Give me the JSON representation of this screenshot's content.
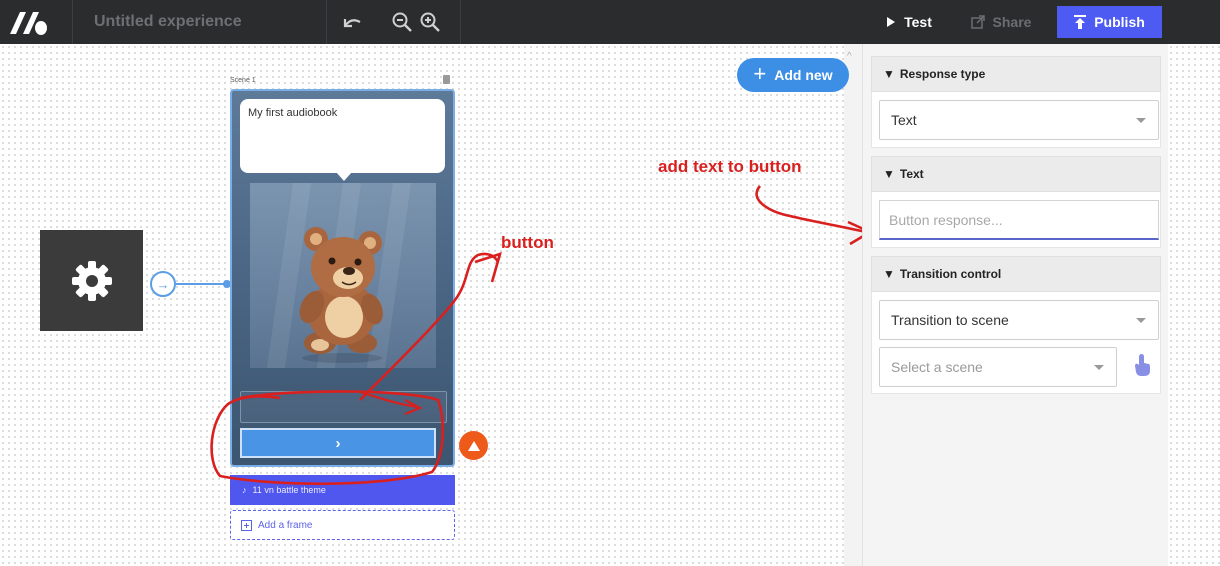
{
  "app": {
    "title": "Untitled experience",
    "buttons": {
      "test": "Test",
      "share": "Share",
      "publish": "Publish"
    }
  },
  "canvas": {
    "add_new": "Add new",
    "scene_label": "Scene 1",
    "bubble_text": "My first audiobook",
    "next_glyph": "›",
    "theme_label": "11 vn battle theme",
    "add_frame": "Add a frame"
  },
  "annotations": {
    "button": "button",
    "add_text": "add text to button"
  },
  "panel": {
    "response_type": {
      "header": "Response type",
      "value": "Text"
    },
    "text": {
      "header": "Text",
      "placeholder": "Button response..."
    },
    "transition": {
      "header": "Transition control",
      "value": "Transition to scene",
      "scene_placeholder": "Select a scene"
    }
  },
  "colors": {
    "accent": "#4d5bf2",
    "add_new": "#3d8fe6",
    "annotation": "#d9201f",
    "warning": "#ee5a1a"
  }
}
